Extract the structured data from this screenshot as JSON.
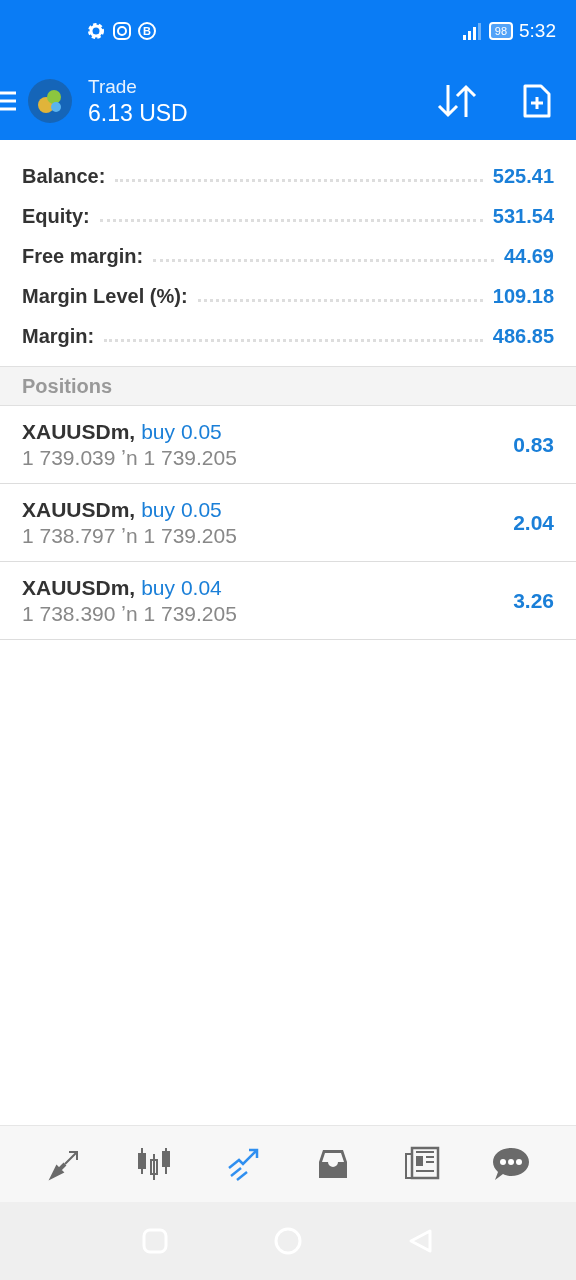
{
  "status_bar": {
    "badge_letter": "B",
    "battery": "98",
    "time": "5:32"
  },
  "app_bar": {
    "title": "Trade",
    "balance": "6.13 USD"
  },
  "summary": [
    {
      "label": "Balance:",
      "value": "525.41"
    },
    {
      "label": "Equity:",
      "value": "531.54"
    },
    {
      "label": "Free margin:",
      "value": "44.69"
    },
    {
      "label": "Margin Level (%):",
      "value": "109.18"
    },
    {
      "label": "Margin:",
      "value": "486.85"
    }
  ],
  "positions": {
    "title": "Positions",
    "rows": [
      {
        "symbol": "XAUUSDm,",
        "order": "buy 0.05",
        "prices": "1 739.039 ʼn  1 739.205",
        "profit": "0.83"
      },
      {
        "symbol": "XAUUSDm,",
        "order": "buy 0.05",
        "prices": "1 738.797 ʼn  1 739.205",
        "profit": "2.04"
      },
      {
        "symbol": "XAUUSDm,",
        "order": "buy 0.04",
        "prices": "1 738.390 ʼn  1 739.205",
        "profit": "3.26"
      }
    ]
  },
  "bottom_nav": [
    {
      "kind": "quotes",
      "selected": false
    },
    {
      "kind": "chart",
      "selected": false
    },
    {
      "kind": "trade",
      "selected": true
    },
    {
      "kind": "history",
      "selected": false
    },
    {
      "kind": "news",
      "selected": false
    },
    {
      "kind": "chat",
      "selected": false
    }
  ]
}
